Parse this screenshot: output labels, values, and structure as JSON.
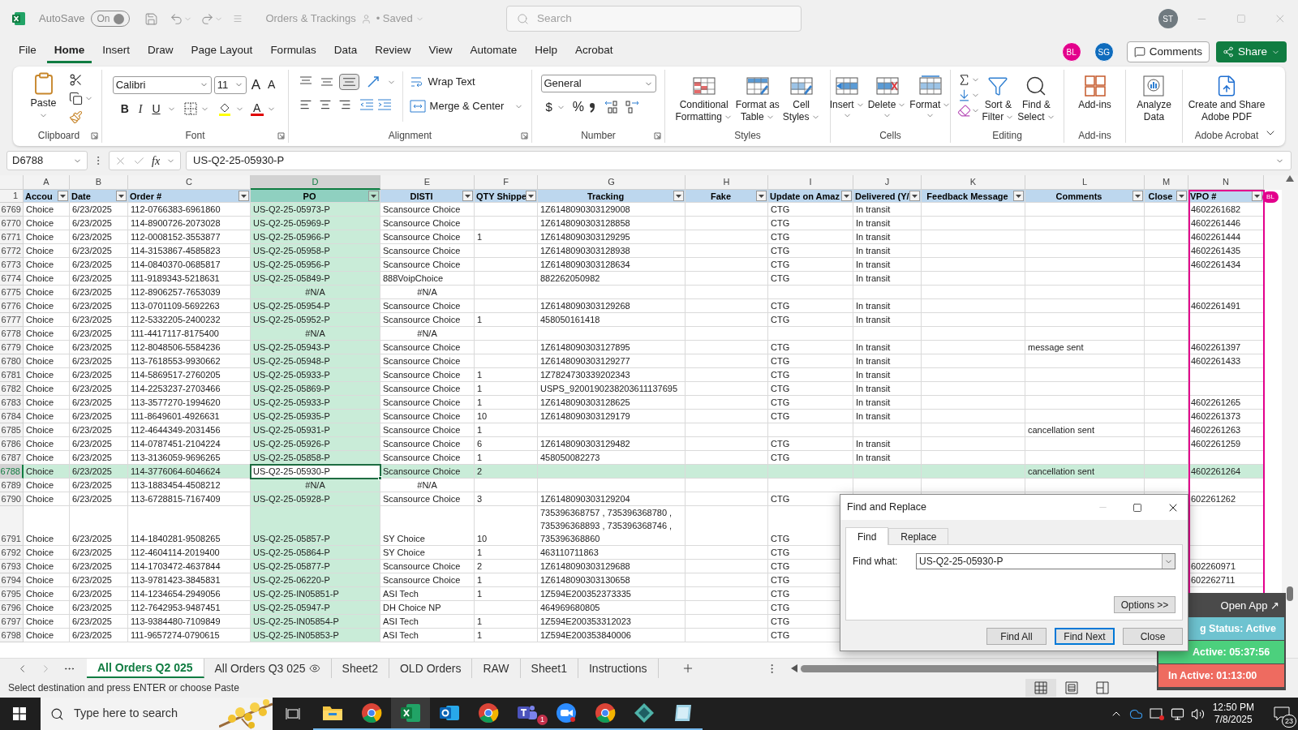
{
  "title_bar": {
    "autosave_label": "AutoSave",
    "autosave_state": "On",
    "autosave_on": true,
    "document_title": "Orders & Trackings",
    "save_status": "• Saved",
    "user_initials": "ST"
  },
  "search": {
    "placeholder": "Search"
  },
  "menu_tabs": [
    {
      "label": "File",
      "selected": false
    },
    {
      "label": "Home",
      "selected": true
    },
    {
      "label": "Insert",
      "selected": false
    },
    {
      "label": "Draw",
      "selected": false
    },
    {
      "label": "Page Layout",
      "selected": false
    },
    {
      "label": "Formulas",
      "selected": false
    },
    {
      "label": "Data",
      "selected": false
    },
    {
      "label": "Review",
      "selected": false
    },
    {
      "label": "View",
      "selected": false
    },
    {
      "label": "Automate",
      "selected": false
    },
    {
      "label": "Help",
      "selected": false
    },
    {
      "label": "Acrobat",
      "selected": false
    }
  ],
  "collaborators": [
    {
      "initials": "BL",
      "color": "#e3008c"
    },
    {
      "initials": "SG",
      "color": "#0f6cbd"
    }
  ],
  "buttons": {
    "comments": "Comments",
    "share": "Share"
  },
  "ribbon": {
    "groups": [
      {
        "kind": "clipboard",
        "label": "Clipboard",
        "paste": "Paste"
      },
      {
        "kind": "font",
        "label": "Font",
        "font_name": "Calibri",
        "font_size": "11",
        "grow": "A",
        "shrink": "A",
        "bold": "B",
        "italic": "I",
        "underline": "U",
        "font_color": "A"
      },
      {
        "kind": "alignment",
        "label": "Alignment",
        "wrap_text": "Wrap Text",
        "merge": "Merge & Center",
        "bottom_align_on": true
      },
      {
        "kind": "number",
        "label": "Number",
        "format": "General",
        "currency": "$",
        "percent": "%"
      },
      {
        "kind": "styles",
        "label": "Styles",
        "buttons": [
          [
            "Conditional",
            "Formatting"
          ],
          [
            "Format as",
            "Table"
          ],
          [
            "Cell",
            "Styles"
          ]
        ]
      },
      {
        "kind": "cells",
        "label": "Cells",
        "buttons": [
          [
            "Insert"
          ],
          [
            "Delete"
          ],
          [
            "Format"
          ]
        ]
      },
      {
        "kind": "editing",
        "label": "Editing",
        "buttons": [
          [
            "Sort &",
            "Filter"
          ],
          [
            "Find &",
            "Select"
          ]
        ]
      },
      {
        "kind": "addins",
        "label": "Add-ins",
        "buttons": [
          [
            "Add-ins"
          ]
        ]
      },
      {
        "kind": "analyze",
        "buttons": [
          [
            "Analyze",
            "Data"
          ]
        ]
      },
      {
        "kind": "acrobat",
        "label": "Adobe Acrobat",
        "buttons": [
          [
            "Create and Share",
            "Adobe PDF"
          ]
        ]
      }
    ]
  },
  "formula_bar": {
    "name_box": "D6788",
    "fx": "fx",
    "formula": "US-Q2-25-05930-P"
  },
  "columns": [
    {
      "letter": "A",
      "selected": false
    },
    {
      "letter": "B",
      "selected": false
    },
    {
      "letter": "C",
      "selected": false
    },
    {
      "letter": "D",
      "selected": true
    },
    {
      "letter": "E",
      "selected": false
    },
    {
      "letter": "F",
      "selected": false
    },
    {
      "letter": "G",
      "selected": false
    },
    {
      "letter": "H",
      "selected": false
    },
    {
      "letter": "I",
      "selected": false
    },
    {
      "letter": "J",
      "selected": false
    },
    {
      "letter": "K",
      "selected": false
    },
    {
      "letter": "L",
      "selected": false
    },
    {
      "letter": "M",
      "selected": false
    },
    {
      "letter": "N",
      "selected": false
    }
  ],
  "header_row": {
    "row": "1",
    "cells": [
      "Accou",
      "Date",
      "Order #",
      "PO",
      "DISTI",
      "QTY Shippe",
      "Tracking",
      "Fake",
      "Update on Amaz",
      "Delivered (Y/",
      "Feedback Message",
      "Comments",
      "Close",
      "VPO #"
    ]
  },
  "rows": [
    {
      "row": "6769",
      "account": "Choice",
      "date": "6/23/2025",
      "order": "112-0766383-6961860",
      "po": "US-Q2-25-05973-P",
      "disti": "Scansource Choice",
      "tracking": "1Z6148090303129008",
      "update": "CTG",
      "delivered": "In transit",
      "vpo": "4602261682",
      "selected": false
    },
    {
      "row": "6770",
      "account": "Choice",
      "date": "6/23/2025",
      "order": "114-8900726-2073028",
      "po": "US-Q2-25-05969-P",
      "disti": "Scansource Choice",
      "tracking": "1Z6148090303128858",
      "update": "CTG",
      "delivered": "In transit",
      "vpo": "4602261446",
      "selected": false
    },
    {
      "row": "6771",
      "account": "Choice",
      "date": "6/23/2025",
      "order": "112-0008152-3553877",
      "po": "US-Q2-25-05966-P",
      "disti": "Scansource Choice",
      "qty": "1",
      "tracking": "1Z6148090303129295",
      "update": "CTG",
      "delivered": "In transit",
      "vpo": "4602261444",
      "selected": false
    },
    {
      "row": "6772",
      "account": "Choice",
      "date": "6/23/2025",
      "order": "114-3153867-4585823",
      "po": "US-Q2-25-05958-P",
      "disti": "Scansource Choice",
      "tracking": "1Z6148090303128938",
      "update": "CTG",
      "delivered": "In transit",
      "vpo": "4602261435",
      "selected": false
    },
    {
      "row": "6773",
      "account": "Choice",
      "date": "6/23/2025",
      "order": "114-0840370-0685817",
      "po": "US-Q2-25-05956-P",
      "disti": "Scansource Choice",
      "tracking": "1Z6148090303128634",
      "update": "CTG",
      "delivered": "In transit",
      "vpo": "4602261434",
      "selected": false
    },
    {
      "row": "6774",
      "account": "Choice",
      "date": "6/23/2025",
      "order": "111-9189343-5218631",
      "po": "US-Q2-25-05849-P",
      "disti": "888VoipChoice",
      "tracking": "882262050982",
      "update": "CTG",
      "delivered": "In transit",
      "selected": false
    },
    {
      "row": "6775",
      "kind": "error",
      "account": "Choice",
      "date": "6/23/2025",
      "order": "112-8906257-7653039",
      "po": "#N/A",
      "disti": "#N/A",
      "selected": false
    },
    {
      "row": "6776",
      "account": "Choice",
      "date": "6/23/2025",
      "order": "113-0701109-5692263",
      "po": "US-Q2-25-05954-P",
      "disti": "Scansource Choice",
      "tracking": "1Z6148090303129268",
      "update": "CTG",
      "delivered": "In transit",
      "vpo": "4602261491",
      "selected": false
    },
    {
      "row": "6777",
      "account": "Choice",
      "date": "6/23/2025",
      "order": "112-5332205-2400232",
      "po": "US-Q2-25-05952-P",
      "disti": "Scansource Choice",
      "qty": "1",
      "tracking": "458050161418",
      "update": "CTG",
      "delivered": "In transit",
      "selected": false
    },
    {
      "row": "6778",
      "kind": "error",
      "account": "Choice",
      "date": "6/23/2025",
      "order": "111-4417117-8175400",
      "po": "#N/A",
      "disti": "#N/A",
      "selected": false
    },
    {
      "row": "6779",
      "account": "Choice",
      "date": "6/23/2025",
      "order": "112-8048506-5584236",
      "po": "US-Q2-25-05943-P",
      "disti": "Scansource Choice",
      "tracking": "1Z6148090303127895",
      "update": "CTG",
      "delivered": "In transit",
      "comments": "message sent",
      "vpo": "4602261397",
      "selected": false
    },
    {
      "row": "6780",
      "account": "Choice",
      "date": "6/23/2025",
      "order": "113-7618553-9930662",
      "po": "US-Q2-25-05948-P",
      "disti": "Scansource Choice",
      "tracking": "1Z6148090303129277",
      "update": "CTG",
      "delivered": "In transit",
      "vpo": "4602261433",
      "selected": false
    },
    {
      "row": "6781",
      "account": "Choice",
      "date": "6/23/2025",
      "order": "114-5869517-2760205",
      "po": "US-Q2-25-05933-P",
      "disti": "Scansource Choice",
      "qty": "1",
      "tracking": "1Z7824730339202343",
      "update": "CTG",
      "delivered": "In transit",
      "selected": false
    },
    {
      "row": "6782",
      "account": "Choice",
      "date": "6/23/2025",
      "order": "114-2253237-2703466",
      "po": "US-Q2-25-05869-P",
      "disti": "Scansource Choice",
      "qty": "1",
      "tracking": "USPS_9200190238203611137695",
      "update": "CTG",
      "delivered": "In transit",
      "selected": false
    },
    {
      "row": "6783",
      "account": "Choice",
      "date": "6/23/2025",
      "order": "113-3577270-1994620",
      "po": "US-Q2-25-05933-P",
      "disti": "Scansource Choice",
      "qty": "1",
      "tracking": "1Z6148090303128625",
      "update": "CTG",
      "delivered": "In transit",
      "vpo": "4602261265",
      "selected": false
    },
    {
      "row": "6784",
      "account": "Choice",
      "date": "6/23/2025",
      "order": "111-8649601-4926631",
      "po": "US-Q2-25-05935-P",
      "disti": "Scansource Choice",
      "qty": "10",
      "tracking": "1Z6148090303129179",
      "update": "CTG",
      "delivered": "In transit",
      "vpo": "4602261373",
      "selected": false
    },
    {
      "row": "6785",
      "account": "Choice",
      "date": "6/23/2025",
      "order": "112-4644349-2031456",
      "po": "US-Q2-25-05931-P",
      "disti": "Scansource Choice",
      "qty": "1",
      "comments": "cancellation sent",
      "vpo": "4602261263",
      "selected": false
    },
    {
      "row": "6786",
      "account": "Choice",
      "date": "6/23/2025",
      "order": "114-0787451-2104224",
      "po": "US-Q2-25-05926-P",
      "disti": "Scansource Choice",
      "qty": "6",
      "tracking": "1Z6148090303129482",
      "update": "CTG",
      "delivered": "In transit",
      "vpo": "4602261259",
      "selected": false
    },
    {
      "row": "6787",
      "account": "Choice",
      "date": "6/23/2025",
      "order": "113-3136059-9696265",
      "po": "US-Q2-25-05858-P",
      "disti": "Scansource Choice",
      "qty": "1",
      "tracking": "458050082273",
      "update": "CTG",
      "delivered": "In transit",
      "selected": false
    },
    {
      "row": "6788",
      "account": "Choice",
      "date": "6/23/2025",
      "order": "114-3776064-6046624",
      "po": "US-Q2-25-05930-P",
      "disti": "Scansource Choice",
      "qty": "2",
      "comments": "cancellation sent",
      "vpo": "4602261264",
      "selected": true
    },
    {
      "row": "6789",
      "kind": "error",
      "account": "Choice",
      "date": "6/23/2025",
      "order": "113-1883454-4508212",
      "po": "#N/A",
      "disti": "#N/A",
      "selected": false
    },
    {
      "row": "6790",
      "account": "Choice",
      "date": "6/23/2025",
      "order": "113-6728815-7167409",
      "po": "US-Q2-25-05928-P",
      "disti": "Scansource Choice",
      "qty": "3",
      "tracking": "1Z6148090303129204",
      "update": "CTG",
      "vpo": "602261262",
      "selected": false
    },
    {
      "row": "6791",
      "account": "Choice",
      "date": "6/23/2025",
      "order": "114-1840281-9508265",
      "po": "US-Q2-25-05857-P",
      "disti": "SY Choice",
      "qty": "10",
      "tracking": "735396368757 , 735396368780 , 735396368893 , 735396368746 , 735396368860",
      "update": "CTG",
      "selected": false
    },
    {
      "row": "6792",
      "account": "Choice",
      "date": "6/23/2025",
      "order": "112-4604114-2019400",
      "po": "US-Q2-25-05864-P",
      "disti": "SY Choice",
      "qty": "1",
      "tracking": "463110711863",
      "update": "CTG",
      "selected": false
    },
    {
      "row": "6793",
      "account": "Choice",
      "date": "6/23/2025",
      "order": "114-1703472-4637844",
      "po": "US-Q2-25-05877-P",
      "disti": "Scansource Choice",
      "qty": "2",
      "tracking": "1Z6148090303129688",
      "update": "CTG",
      "vpo": "602260971",
      "selected": false
    },
    {
      "row": "6794",
      "account": "Choice",
      "date": "6/23/2025",
      "order": "113-9781423-3845831",
      "po": "US-Q2-25-06220-P",
      "disti": "Scansource Choice",
      "qty": "1",
      "tracking": "1Z6148090303130658",
      "update": "CTG",
      "vpo": "602262711",
      "selected": false
    },
    {
      "row": "6795",
      "account": "Choice",
      "date": "6/23/2025",
      "order": "114-1234654-2949056",
      "po": "US-Q2-25-IN05851-P",
      "disti": "ASI Tech",
      "qty": "1",
      "tracking": "1Z594E200352373335",
      "update": "CTG",
      "selected": false
    },
    {
      "row": "6796",
      "account": "Choice",
      "date": "6/23/2025",
      "order": "112-7642953-9487451",
      "po": "US-Q2-25-05947-P",
      "disti": "DH Choice NP",
      "tracking": "464969680805",
      "update": "CTG",
      "selected": false
    },
    {
      "row": "6797",
      "account": "Choice",
      "date": "6/23/2025",
      "order": "113-9384480-7109849",
      "po": "US-Q2-25-IN05854-P",
      "disti": "ASI Tech",
      "qty": "1",
      "tracking": "1Z594E200353312023",
      "update": "CTG",
      "selected": false
    },
    {
      "row": "6798",
      "account": "Choice",
      "date": "6/23/2025",
      "order": "111-9657274-0790615",
      "po": "US-Q2-25-IN05853-P",
      "disti": "ASI Tech",
      "qty": "1",
      "tracking": "1Z594E200353840006",
      "update": "CTG",
      "selected": false
    }
  ],
  "presence": {
    "initials": "BL",
    "color": "#e3008c"
  },
  "dialog": {
    "title": "Find and Replace",
    "tabs": [
      {
        "label": "Find",
        "selected": true
      },
      {
        "label": "Replace",
        "selected": false
      }
    ],
    "find_label": "Find what:",
    "find_value": "US-Q2-25-05930-P",
    "options": "Options >>",
    "buttons": [
      {
        "label": "Find All",
        "default": false
      },
      {
        "label": "Find Next",
        "default": true
      },
      {
        "label": "Close",
        "default": false
      }
    ]
  },
  "tracker": {
    "open_app": "Open App ↗",
    "status": "g Status: Active",
    "active": "Active: 05:37:56",
    "inactive": "In Active: 01:13:00"
  },
  "sheet_tabs": [
    {
      "label": "All Orders Q2 025",
      "selected": true,
      "kind": "plain"
    },
    {
      "label": "All Orders Q3 025",
      "selected": false,
      "kind": "watched"
    },
    {
      "label": "Sheet2",
      "selected": false,
      "kind": "plain"
    },
    {
      "label": "OLD Orders",
      "selected": false,
      "kind": "plain"
    },
    {
      "label": "RAW",
      "selected": false,
      "kind": "plain"
    },
    {
      "label": "Sheet1",
      "selected": false,
      "kind": "plain"
    },
    {
      "label": "Instructions",
      "selected": false,
      "kind": "plain"
    }
  ],
  "status_bar": {
    "message": "Select destination and press ENTER or choose Paste",
    "views": [
      {
        "kind": "normal",
        "selected": true
      },
      {
        "kind": "page_layout",
        "selected": false
      },
      {
        "kind": "page_break",
        "selected": false
      }
    ]
  },
  "taskbar": {
    "search_placeholder": "Type here to search",
    "apps": [
      {
        "kind": "explorer"
      },
      {
        "kind": "chrome"
      },
      {
        "kind": "excel"
      },
      {
        "kind": "outlook"
      },
      {
        "kind": "chrome"
      },
      {
        "kind": "teams",
        "badge": "1"
      },
      {
        "kind": "zoom"
      },
      {
        "kind": "chrome"
      },
      {
        "kind": "diamond"
      },
      {
        "kind": "notes"
      }
    ],
    "time": "12:50 PM",
    "date": "7/8/2025",
    "notifications": "23"
  }
}
